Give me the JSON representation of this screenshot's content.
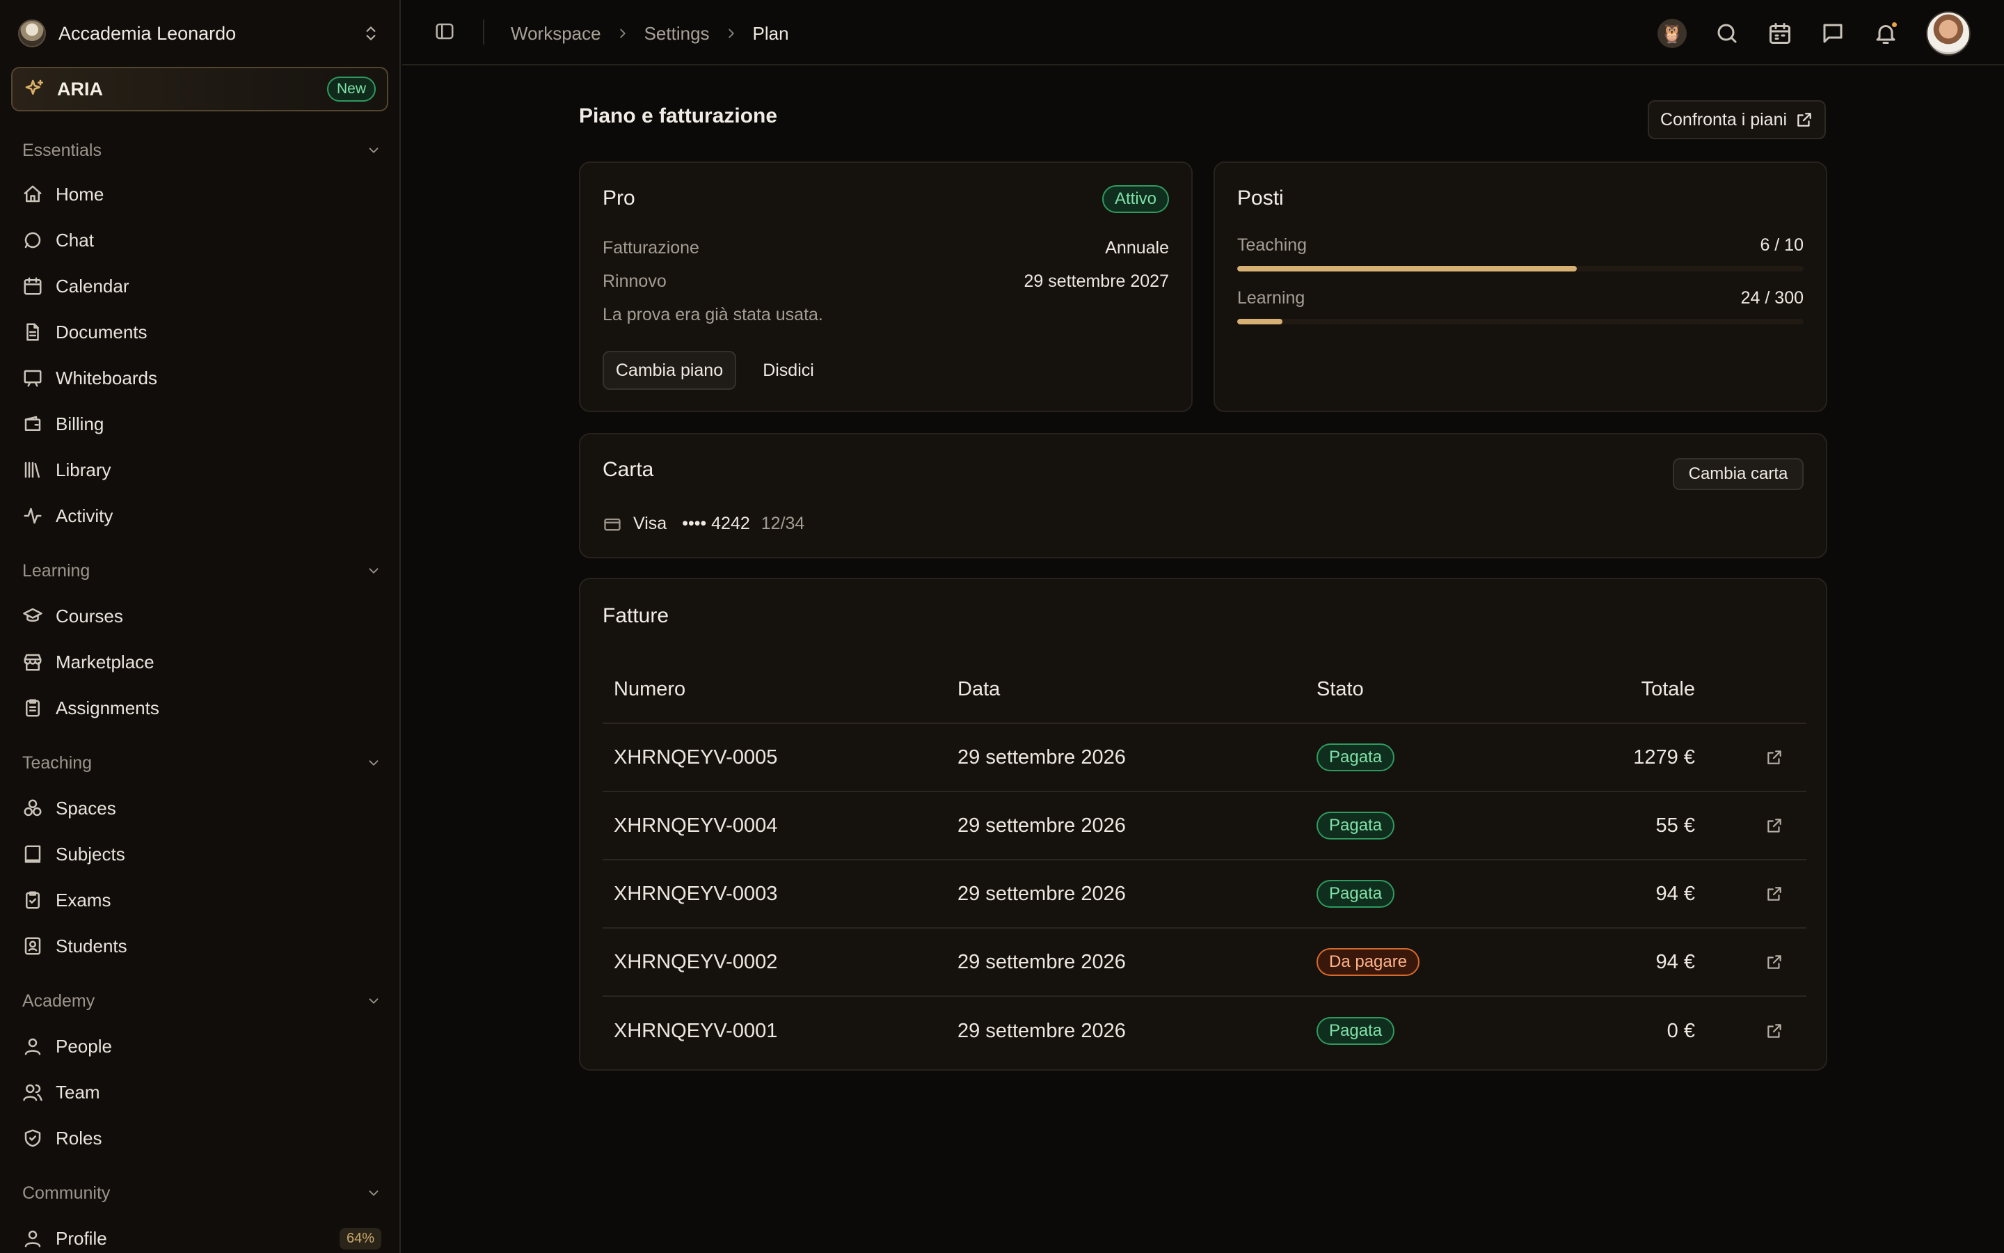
{
  "org": {
    "name": "Accademia Leonardo"
  },
  "aria": {
    "label": "ARIA",
    "badge": "New"
  },
  "sidebar": {
    "sections": [
      {
        "title": "Essentials",
        "items": [
          "Home",
          "Chat",
          "Calendar",
          "Documents",
          "Whiteboards",
          "Billing",
          "Library",
          "Activity"
        ]
      },
      {
        "title": "Learning",
        "items": [
          "Courses",
          "Marketplace",
          "Assignments"
        ]
      },
      {
        "title": "Teaching",
        "items": [
          "Spaces",
          "Subjects",
          "Exams",
          "Students"
        ]
      },
      {
        "title": "Academy",
        "items": [
          "People",
          "Team",
          "Roles"
        ]
      },
      {
        "title": "Community",
        "items": [
          "Profile"
        ]
      }
    ],
    "profile_badge": "64%"
  },
  "breadcrumb": [
    "Workspace",
    "Settings",
    "Plan"
  ],
  "page": {
    "title": "Piano e fatturazione",
    "compare_label": "Confronta i piani"
  },
  "plan": {
    "name": "Pro",
    "status": "Attivo",
    "billing_label": "Fatturazione",
    "billing_value": "Annuale",
    "renewal_label": "Rinnovo",
    "renewal_value": "29 settembre 2027",
    "note": "La prova era già stata usata.",
    "change_label": "Cambia piano",
    "cancel_label": "Disdici"
  },
  "seats": {
    "title": "Posti",
    "items": [
      {
        "label": "Teaching",
        "value": "6 / 10",
        "used": 6,
        "total": 10
      },
      {
        "label": "Learning",
        "value": "24 / 300",
        "used": 24,
        "total": 300
      }
    ]
  },
  "card": {
    "title": "Carta",
    "change_label": "Cambia carta",
    "brand": "Visa",
    "number": "•••• 4242",
    "expiry": "12/34"
  },
  "invoices": {
    "title": "Fatture",
    "columns": [
      "Numero",
      "Data",
      "Stato",
      "Totale"
    ],
    "rows": [
      {
        "number": "XHRNQEYV-0005",
        "date": "29 settembre 2026",
        "status": "Pagata",
        "status_kind": "paid",
        "total": "1279 €"
      },
      {
        "number": "XHRNQEYV-0004",
        "date": "29 settembre 2026",
        "status": "Pagata",
        "status_kind": "paid",
        "total": "55 €"
      },
      {
        "number": "XHRNQEYV-0003",
        "date": "29 settembre 2026",
        "status": "Pagata",
        "status_kind": "paid",
        "total": "94 €"
      },
      {
        "number": "XHRNQEYV-0002",
        "date": "29 settembre 2026",
        "status": "Da pagare",
        "status_kind": "due",
        "total": "94 €"
      },
      {
        "number": "XHRNQEYV-0001",
        "date": "29 settembre 2026",
        "status": "Pagata",
        "status_kind": "paid",
        "total": "0 €"
      }
    ]
  },
  "colors": {
    "accent": "#d7b073",
    "paid": "#2f9a60",
    "due": "#d46a2d",
    "background": "#0c0a08"
  }
}
